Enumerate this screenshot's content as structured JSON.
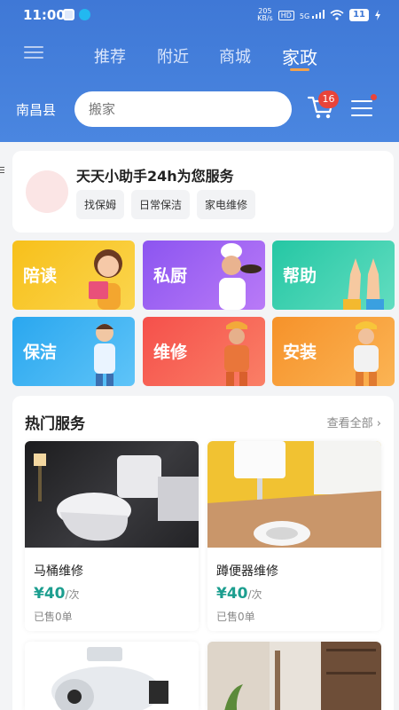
{
  "status_bar": {
    "time": "11:00",
    "network_speed_value": "205",
    "network_speed_unit": "KB/s",
    "hd": "HD",
    "network": "5G",
    "battery": "11"
  },
  "nav": {
    "tabs": [
      "推荐",
      "附近",
      "商城",
      "家政"
    ],
    "active_tab": "家政"
  },
  "location": {
    "city": "南昌县"
  },
  "search": {
    "placeholder": "搬家"
  },
  "cart": {
    "badge_count": "16"
  },
  "assistant": {
    "title": "天天小助手24h为您服务",
    "chips": [
      "找保姆",
      "日常保洁",
      "家电维修"
    ]
  },
  "categories": [
    {
      "label": "陪读",
      "color_start": "#f7c01b",
      "color_end": "#fbd54d"
    },
    {
      "label": "私厨",
      "color_start": "#8c55f0",
      "color_end": "#b97af7"
    },
    {
      "label": "帮助",
      "color_start": "#25c7a4",
      "color_end": "#62ddc0"
    },
    {
      "label": "保洁",
      "color_start": "#2aa7ef",
      "color_end": "#5fc4f8"
    },
    {
      "label": "维修",
      "color_start": "#f5504b",
      "color_end": "#fa7f66"
    },
    {
      "label": "安装",
      "color_start": "#f6922a",
      "color_end": "#fbb454"
    }
  ],
  "hot_services": {
    "title": "热门服务",
    "see_all": "查看全部 ›",
    "items": [
      {
        "name": "马桶维修",
        "price": "¥40",
        "unit": "/次",
        "sold": "已售0单"
      },
      {
        "name": "蹲便器维修",
        "price": "¥40",
        "unit": "/次",
        "sold": "已售0单"
      }
    ]
  },
  "colors": {
    "header_blue": "#3f78d6",
    "accent_orange": "#f2a24d",
    "badge_red": "#e8443a",
    "price_teal": "#1c9e8f"
  }
}
